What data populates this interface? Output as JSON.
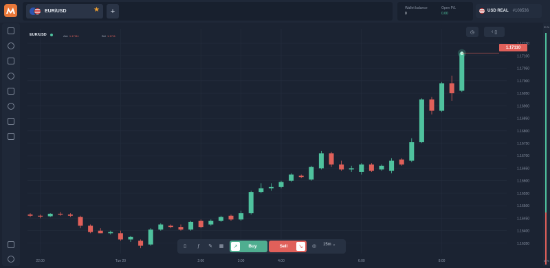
{
  "header": {
    "tab": {
      "pair": "EUR/USD"
    },
    "add_tab_label": "+",
    "wallet_balance_label": "Wallet balance",
    "wallet_balance_value": "0",
    "open_pl_label": "Open P/L",
    "open_pl_value": "0.00",
    "account_name": "USD REAL",
    "account_id": "#108536"
  },
  "sidebar": {
    "icons": [
      "dashboard-icon",
      "analytics-icon",
      "portfolio-icon",
      "history-icon",
      "education-icon",
      "settings-icon",
      "chat-icon",
      "calendar-icon",
      "collapse-icon",
      "help-icon"
    ]
  },
  "chart_header": {
    "pair": "EUR/USD",
    "ask_label": "Ask",
    "ask_value": "1.17111",
    "bid_label": "Bid",
    "bid_value": "1.1711"
  },
  "current_price": "1.17110",
  "right_scale": {
    "top_pct": "31 %",
    "bottom_pct": "69 %"
  },
  "tradebar": {
    "buy_label": "Buy",
    "sell_label": "Sell",
    "timeframe": "15m"
  },
  "colors": {
    "up": "#4fc29e",
    "down": "#e0605a",
    "accent": "#e8783a"
  },
  "chart_data": {
    "type": "candlestick",
    "y_ticks": [
      "1.17150",
      "1.17100",
      "1.17050",
      "1.17000",
      "1.16950",
      "1.16900",
      "1.16850",
      "1.16800",
      "1.16750",
      "1.16700",
      "1.16650",
      "1.16600",
      "1.16550",
      "1.16500",
      "1.16450",
      "1.16400",
      "1.16350"
    ],
    "ylim": [
      1.16325,
      1.17175
    ],
    "x_ticks": [
      {
        "label": "22:00",
        "idx": 1
      },
      {
        "label": "Tue 20",
        "idx": 9
      },
      {
        "label": "2:00",
        "idx": 17
      },
      {
        "label": "3:00",
        "idx": 21
      },
      {
        "label": "4:00",
        "idx": 25
      },
      {
        "label": "6:00",
        "idx": 33
      },
      {
        "label": "8:00",
        "idx": 41
      }
    ],
    "candles": [
      {
        "o": 1.16465,
        "h": 1.1647,
        "l": 1.16455,
        "c": 1.1646
      },
      {
        "o": 1.1646,
        "h": 1.16465,
        "l": 1.1645,
        "c": 1.16458
      },
      {
        "o": 1.16458,
        "h": 1.1647,
        "l": 1.16455,
        "c": 1.16468
      },
      {
        "o": 1.16468,
        "h": 1.16475,
        "l": 1.1646,
        "c": 1.16465
      },
      {
        "o": 1.16465,
        "h": 1.1647,
        "l": 1.16455,
        "c": 1.1646
      },
      {
        "o": 1.16455,
        "h": 1.1646,
        "l": 1.1641,
        "c": 1.1642
      },
      {
        "o": 1.1642,
        "h": 1.16425,
        "l": 1.1639,
        "c": 1.16395
      },
      {
        "o": 1.164,
        "h": 1.1641,
        "l": 1.1639,
        "c": 1.1639
      },
      {
        "o": 1.1639,
        "h": 1.164,
        "l": 1.16385,
        "c": 1.16395
      },
      {
        "o": 1.1639,
        "h": 1.164,
        "l": 1.1636,
        "c": 1.16365
      },
      {
        "o": 1.16365,
        "h": 1.1638,
        "l": 1.16355,
        "c": 1.16375
      },
      {
        "o": 1.1636,
        "h": 1.16365,
        "l": 1.1633,
        "c": 1.1634
      },
      {
        "o": 1.16345,
        "h": 1.1641,
        "l": 1.1634,
        "c": 1.16405
      },
      {
        "o": 1.16405,
        "h": 1.1643,
        "l": 1.164,
        "c": 1.16425
      },
      {
        "o": 1.1642,
        "h": 1.16425,
        "l": 1.1641,
        "c": 1.16415
      },
      {
        "o": 1.16415,
        "h": 1.16425,
        "l": 1.164,
        "c": 1.16405
      },
      {
        "o": 1.16405,
        "h": 1.1644,
        "l": 1.164,
        "c": 1.16435
      },
      {
        "o": 1.1644,
        "h": 1.16445,
        "l": 1.1641,
        "c": 1.16415
      },
      {
        "o": 1.16425,
        "h": 1.16445,
        "l": 1.1642,
        "c": 1.1644
      },
      {
        "o": 1.1644,
        "h": 1.1646,
        "l": 1.16435,
        "c": 1.16455
      },
      {
        "o": 1.1646,
        "h": 1.16465,
        "l": 1.1644,
        "c": 1.16445
      },
      {
        "o": 1.16445,
        "h": 1.1648,
        "l": 1.1644,
        "c": 1.1647
      },
      {
        "o": 1.1647,
        "h": 1.1656,
        "l": 1.16465,
        "c": 1.16555
      },
      {
        "o": 1.16555,
        "h": 1.1659,
        "l": 1.1655,
        "c": 1.1657
      },
      {
        "o": 1.1657,
        "h": 1.1659,
        "l": 1.1656,
        "c": 1.16575
      },
      {
        "o": 1.16575,
        "h": 1.166,
        "l": 1.1657,
        "c": 1.16595
      },
      {
        "o": 1.166,
        "h": 1.1663,
        "l": 1.16595,
        "c": 1.16625
      },
      {
        "o": 1.1662,
        "h": 1.16625,
        "l": 1.1661,
        "c": 1.16615
      },
      {
        "o": 1.16605,
        "h": 1.1666,
        "l": 1.166,
        "c": 1.16655
      },
      {
        "o": 1.1665,
        "h": 1.1672,
        "l": 1.16645,
        "c": 1.1671
      },
      {
        "o": 1.1671,
        "h": 1.16715,
        "l": 1.16655,
        "c": 1.16665
      },
      {
        "o": 1.16665,
        "h": 1.1668,
        "l": 1.1664,
        "c": 1.16645
      },
      {
        "o": 1.16645,
        "h": 1.1666,
        "l": 1.16635,
        "c": 1.1665
      },
      {
        "o": 1.16635,
        "h": 1.1667,
        "l": 1.16625,
        "c": 1.16665
      },
      {
        "o": 1.16665,
        "h": 1.1667,
        "l": 1.16635,
        "c": 1.1664
      },
      {
        "o": 1.16645,
        "h": 1.16665,
        "l": 1.1664,
        "c": 1.1666
      },
      {
        "o": 1.1664,
        "h": 1.1669,
        "l": 1.1663,
        "c": 1.1668
      },
      {
        "o": 1.16685,
        "h": 1.1669,
        "l": 1.1666,
        "c": 1.16665
      },
      {
        "o": 1.1668,
        "h": 1.1677,
        "l": 1.16675,
        "c": 1.16755
      },
      {
        "o": 1.16755,
        "h": 1.1693,
        "l": 1.1675,
        "c": 1.16925
      },
      {
        "o": 1.16925,
        "h": 1.16935,
        "l": 1.16865,
        "c": 1.1688
      },
      {
        "o": 1.1688,
        "h": 1.16995,
        "l": 1.16875,
        "c": 1.1699
      },
      {
        "o": 1.1699,
        "h": 1.1702,
        "l": 1.1692,
        "c": 1.1695
      },
      {
        "o": 1.1696,
        "h": 1.1711,
        "l": 1.16955,
        "c": 1.1711
      }
    ]
  }
}
